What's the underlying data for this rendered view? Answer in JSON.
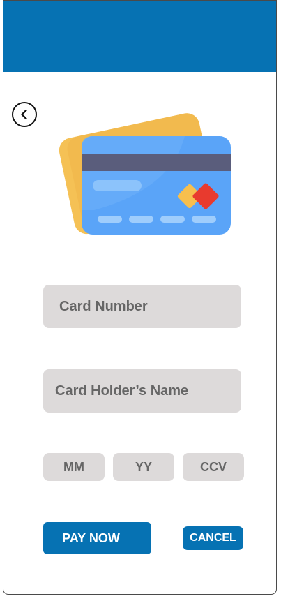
{
  "header": {
    "color": "#0672b3"
  },
  "back_icon": "chevron-left-icon",
  "illustration": {
    "icon": "credit-cards-icon",
    "colors": {
      "card_front": "#5aa4f8",
      "card_back": "#f5c155",
      "stripe": "#5a5d7c",
      "chip_red": "#e83a2e",
      "chip_yellow": "#f7bf4e"
    }
  },
  "form": {
    "card_number_placeholder": "Card Number",
    "holder_name_placeholder": "Card Holder’s Name",
    "mm_placeholder": "MM",
    "yy_placeholder": "YY",
    "ccv_placeholder": "CCV"
  },
  "buttons": {
    "pay_label": "PAY NOW",
    "cancel_label": "CANCEL"
  },
  "colors": {
    "accent": "#0672b3",
    "field_bg": "#dddada",
    "field_text": "#666666"
  }
}
